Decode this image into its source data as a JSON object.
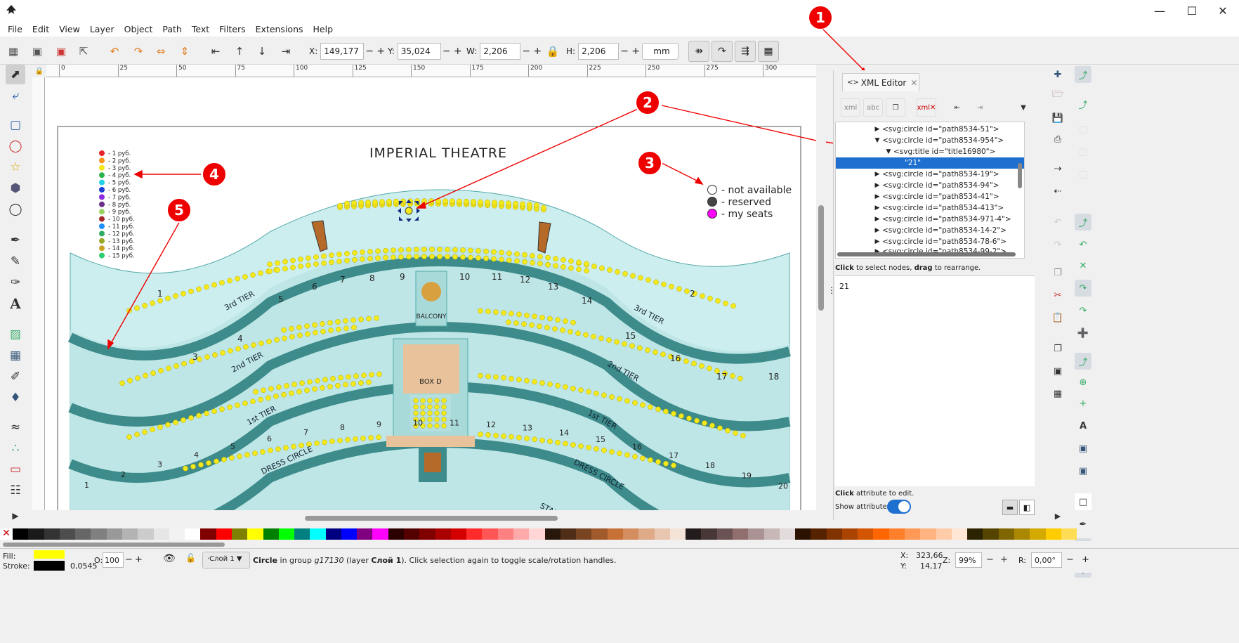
{
  "window": {
    "minimize_icon": "minimize-icon",
    "maximize_icon": "maximize-icon",
    "close_icon": "close-icon"
  },
  "menu": [
    "File",
    "Edit",
    "View",
    "Layer",
    "Object",
    "Path",
    "Text",
    "Filters",
    "Extensions",
    "Help"
  ],
  "toolbar": {
    "x_label": "X:",
    "x_value": "149,177",
    "y_label": "Y:",
    "y_value": "35,024",
    "w_label": "W:",
    "w_value": "2,206",
    "h_label": "H:",
    "h_value": "2,206",
    "unit": "mm"
  },
  "ruler_ticks": [
    "0",
    "25",
    "50",
    "75",
    "100",
    "125",
    "150",
    "175",
    "200",
    "225",
    "250",
    "275",
    "300"
  ],
  "canvas": {
    "title": "IMPERIAL THEATRE",
    "price_legend": [
      "- 1 руб.",
      "- 2 руб.",
      "- 3 руб.",
      "- 4 руб.",
      "- 5 руб.",
      "- 6 руб.",
      "- 7 руб.",
      "- 8 руб.",
      "- 9 руб.",
      "- 10 руб.",
      "- 11 руб.",
      "- 12 руб.",
      "- 13 руб.",
      "- 14 руб.",
      "- 15 руб."
    ],
    "price_colors": [
      "#e8232a",
      "#f7941d",
      "#f4e91a",
      "#2bb24c",
      "#22d2e6",
      "#1a3fd6",
      "#8a2be2",
      "#6b2f8a",
      "#96d35f",
      "#a52a2a",
      "#1e90ff",
      "#33aa66",
      "#9aa82a",
      "#c9a227",
      "#2ecc71"
    ],
    "status_legend": [
      "- not available",
      "- reserved",
      "- my seats"
    ],
    "sections": {
      "balcony": "BALCONY",
      "box": "BOX D",
      "tier3": "3rd TIER",
      "tier2": "2nd TIER",
      "tier1": "1st TIER",
      "dress": "DRESS CIRCLE",
      "stalls": "STALLS"
    },
    "seat_numbers_top": [
      "1",
      "6",
      "7",
      "8",
      "9",
      "10",
      "11",
      "12",
      "13",
      "5",
      "14",
      "2",
      "4",
      "3",
      "15",
      "16",
      "17",
      "18"
    ],
    "seat_numbers_mid": [
      "1",
      "2",
      "3",
      "4",
      "5",
      "6",
      "7",
      "8",
      "9",
      "10",
      "11",
      "12",
      "13",
      "14",
      "15",
      "16",
      "17",
      "18",
      "19",
      "20"
    ]
  },
  "callouts": [
    "1",
    "2",
    "3",
    "4",
    "5"
  ],
  "xml_editor": {
    "tab_label": "XML Editor",
    "nodes": [
      "<svg:circle id=\"path8534-51\">",
      "<svg:circle id=\"path8534-954\">",
      "<svg:title id=\"title16980\">",
      "\"21\"",
      "<svg:circle id=\"path8534-19\">",
      "<svg:circle id=\"path8534-94\">",
      "<svg:circle id=\"path8534-41\">",
      "<svg:circle id=\"path8534-413\">",
      "<svg:circle id=\"path8534-971-4\">",
      "<svg:circle id=\"path8534-14-2\">",
      "<svg:circle id=\"path8534-78-6\">",
      "<svg:circle id=\"path8534-99-2\">"
    ],
    "hint_bold1": "Click",
    "hint1": " to select nodes, ",
    "hint_bold2": "drag",
    "hint2": " to rearrange.",
    "content": "21",
    "attr_hint_bold": "Click",
    "attr_hint": " attribute to edit.",
    "show_attributes": "Show attributes"
  },
  "status": {
    "fill_label": "Fill:",
    "stroke_label": "Stroke:",
    "stroke_width": "0,0545",
    "opacity_label": "O:",
    "opacity": "100",
    "layer": "·Слой 1",
    "message_bold": "Circle",
    "message": " in group ",
    "message_italic": "g17130",
    "message_end": " (layer ",
    "layer_bold": "Слой 1",
    "message_tail": "). Click selection again to toggle scale/rotation handles.",
    "x_label": "X:",
    "x": "323,66",
    "y_label": "Y:",
    "y": "14,17",
    "zoom_label": "Z:",
    "zoom": "99%",
    "rot_label": "R:",
    "rotation": "0,00°"
  },
  "palette": [
    "#000000",
    "#1a1a1a",
    "#333333",
    "#4d4d4d",
    "#666666",
    "#808080",
    "#999999",
    "#b3b3b3",
    "#cccccc",
    "#e6e6e6",
    "#f2f2f2",
    "#ffffff",
    "#800000",
    "#ff0000",
    "#808000",
    "#ffff00",
    "#008000",
    "#00ff00",
    "#008080",
    "#00ffff",
    "#000080",
    "#0000ff",
    "#800080",
    "#ff00ff",
    "#2b0000",
    "#550000",
    "#800000",
    "#aa0000",
    "#d40000",
    "#ff2a2a",
    "#ff5555",
    "#ff8080",
    "#ffaaaa",
    "#ffd5d5",
    "#28170b",
    "#502d16",
    "#784421",
    "#a05a2c",
    "#c87137",
    "#d38d5f",
    "#deaa87",
    "#e9c6af",
    "#f4e3d7",
    "#241c1c",
    "#483737",
    "#6c5353",
    "#916f6f",
    "#ac9393",
    "#c8b7b7",
    "#e3dbdb",
    "#2b1100",
    "#552200",
    "#803300",
    "#aa4400",
    "#d45500",
    "#ff6600",
    "#ff7f2a",
    "#ff9955",
    "#ffb380",
    "#ffccaa",
    "#ffe6d5",
    "#2b2200",
    "#554400",
    "#806600",
    "#aa8800",
    "#d4aa00",
    "#ffcc00",
    "#ffdd55"
  ]
}
